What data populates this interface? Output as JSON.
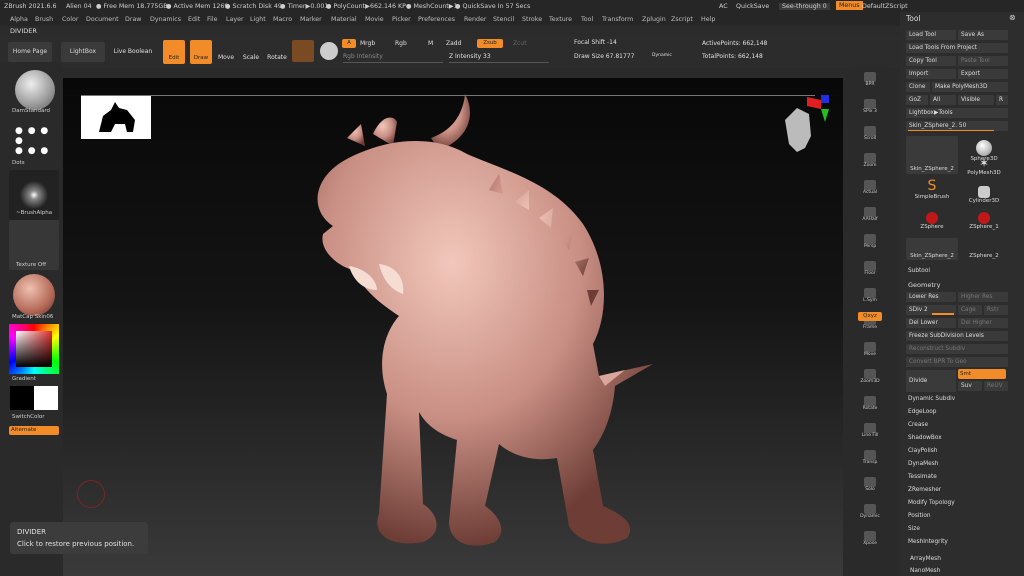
{
  "titlebar": {
    "app": "ZBrush 2021.6.6",
    "doc": "Alien 04",
    "free_mem": "● Free Mem 18.775GB",
    "active_mem": "● Active Mem 1269",
    "scratch": "● Scratch Disk 49",
    "timer": "● Timer▶0.001",
    "polycount": "● PolyCount▶662.146 KP",
    "meshcount": "● MeshCount▶1",
    "quicksave_in": "● QuickSave In 57 Secs",
    "ac": "AC",
    "quicksave": "QuickSave",
    "see_through": "See-through  0",
    "menus": "Menus",
    "default_zscript": "DefaultZScript"
  },
  "menu": [
    "Alpha",
    "Brush",
    "Color",
    "Document",
    "Draw",
    "Dynamics",
    "Edit",
    "File",
    "Layer",
    "Light",
    "Macro",
    "Marker",
    "Material",
    "Movie",
    "Picker",
    "Preferences",
    "Render",
    "Stencil",
    "Stroke",
    "Texture",
    "Tool",
    "Transform",
    "Zplugin",
    "Zscript",
    "Help"
  ],
  "divider": "DIVIDER",
  "toolbar": {
    "home_page": "Home Page",
    "lightbox": "LightBox",
    "live_boolean": "Live Boolean",
    "edit": "Edit",
    "draw": "Draw",
    "move": "Move",
    "scale": "Scale",
    "rotate": "Rotate",
    "a": "A",
    "mrgb": "Mrgb",
    "rgb": "Rgb",
    "m": "M",
    "zadd": "Zadd",
    "zsub": "Zsub",
    "zcut": "Zcut",
    "rgb_intensity": "Rgb Intensity",
    "z_intensity": "Z Intensity 33",
    "focal_shift": "Focal Shift -14",
    "draw_size": "Draw Size 67.81777",
    "dynamic": "Dynamic",
    "active_points": "ActivePoints: 662,148",
    "total_points": "TotalPoints: 662,148"
  },
  "leftshelf": {
    "brush": "DamStandard",
    "stroke": "Dots",
    "alpha": "~BrushAlpha",
    "texture": "Texture Off",
    "material": "MatCap Skin06",
    "gradient": "Gradient",
    "switch_color": "SwitchColor",
    "alternate": "Alternate"
  },
  "rightshelf": [
    "BPR",
    "SPix 3",
    "Scroll",
    "Zoom",
    "Actual",
    "AAHalf",
    "Persp",
    "Floor",
    "L.Sym",
    "Frame",
    "Move",
    "Zoom3D",
    "Rotate",
    "Line Fill",
    "Transp",
    "Solo",
    "Dynamic",
    "Xpose"
  ],
  "rightshelf_qxyz": "Qxyz",
  "toolpanel": {
    "title": "Tool",
    "load_tool": "Load Tool",
    "save_as": "Save As",
    "load_tools_from_project": "Load Tools From Project",
    "copy_tool": "Copy Tool",
    "paste_tool": "Paste Tool",
    "import": "Import",
    "export": "Export",
    "clone": "Clone",
    "make_polymesh": "Make PolyMesh3D",
    "goz": "GoZ",
    "all": "All",
    "visible": "Visible",
    "r": "R",
    "lightbox_tools": "Lightbox▶Tools",
    "current_tool": "Skin_ZSphere_2. 50",
    "thumbs": [
      "Skin_ZSphere_2",
      "Sphere3D",
      "SimpleBrush",
      "PolyMesh3D",
      "ZSphere",
      "Cylinder3D",
      "Skin_ZSphere_2",
      "ZSphere_1",
      "ZSphere_2"
    ],
    "subtool": "Subtool",
    "geometry": "Geometry",
    "lower_res": "Lower Res",
    "higher_res": "Higher Res",
    "sdiv": "SDiv 2",
    "cage": "Cage",
    "rstr": "Rstr",
    "del_lower": "Del Lower",
    "del_higher": "Del Higher",
    "freeze": "Freeze SubDivision Levels",
    "reconstruct": "Reconstruct Subdiv",
    "convert_bpr": "Convert BPR To Geo",
    "divide": "Divide",
    "smt": "Smt",
    "suv": "Suv",
    "reuv": "ReUV",
    "items": [
      "Dynamic Subdiv",
      "EdgeLoop",
      "Crease",
      "ShadowBox",
      "ClayPolish",
      "DynaMesh",
      "Tessimate",
      "ZRemesher",
      "Modify Topology",
      "Position",
      "Size",
      "MeshIntegrity"
    ],
    "array_mesh": "ArrayMesh",
    "nano_mesh": "NanoMesh"
  },
  "restore": {
    "title": "DIVIDER",
    "text": "Click to restore previous position."
  },
  "colors": {
    "accent": "#f28c28",
    "panel": "#2d2d2d",
    "skin": "#c98f84"
  }
}
